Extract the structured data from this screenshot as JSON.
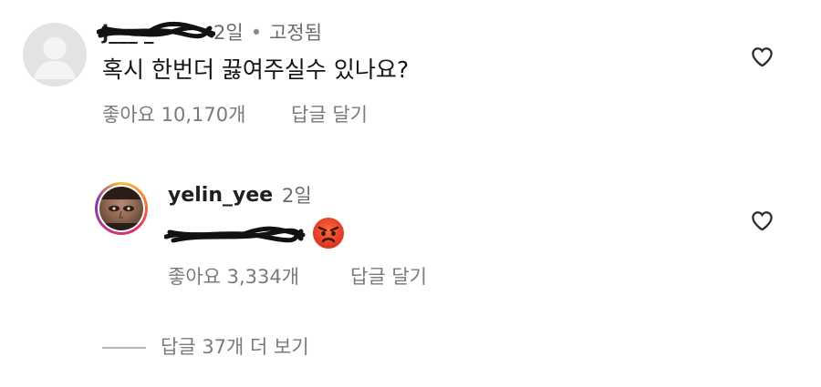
{
  "comment": {
    "username": "j___ _",
    "time": "2일",
    "separator": "•",
    "pinned": "고정됨",
    "text": "혹시 한번더 끓여주실수 있나요?",
    "likes_label": "좋아요 10,170개",
    "reply_label": "답글 달기"
  },
  "reply": {
    "username": "yelin_yee",
    "time": "2일",
    "emoji": "angry-face",
    "likes_label": "좋아요 3,334개",
    "reply_label": "답글 달기"
  },
  "view_more": {
    "label": "답글 37개 더 보기"
  },
  "icons": {
    "like": "heart-outline-icon",
    "story_ring": "instagram-story-gradient"
  },
  "colors": {
    "text_primary": "#1f1f1f",
    "text_secondary": "#7a7a7a",
    "emoji": "#e8452a"
  }
}
